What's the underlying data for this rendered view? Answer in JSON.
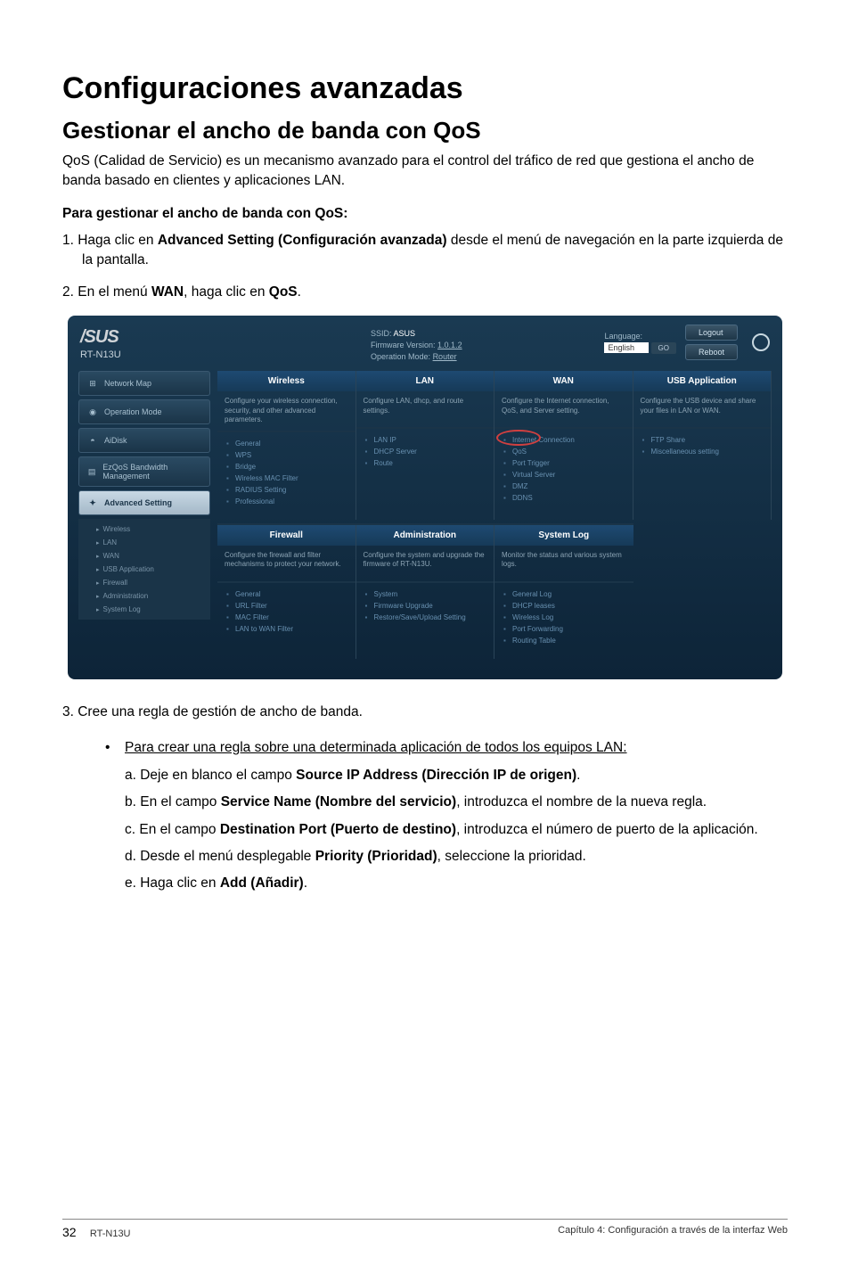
{
  "page": {
    "title": "Configuraciones avanzadas",
    "subtitle": "Gestionar el ancho de banda con QoS",
    "intro": "QoS (Calidad de Servicio) es un mecanismo avanzado para el control del tráfico de red que gestiona el ancho de banda basado en clientes y aplicaciones LAN.",
    "subheading": "Para gestionar el ancho de banda con QoS:",
    "step1_pre": "1.  Haga clic en ",
    "step1_bold": "Advanced Setting (Configuración avanzada)",
    "step1_post": " desde el menú de navegación en la parte izquierda de la pantalla.",
    "step2_pre": "2.  En el menú ",
    "step2_bold1": "WAN",
    "step2_mid": ", haga clic en ",
    "step2_bold2": "QoS",
    "step2_end": ".",
    "step3": "3.  Cree una regla de gestión de ancho de banda.",
    "bullet_head": "Para crear una regla sobre una determinada aplicación de todos los equipos LAN:",
    "letters": {
      "a": {
        "pre": "a. Deje en blanco el campo ",
        "b": "Source IP Address (Dirección IP de origen)",
        "post": "."
      },
      "b": {
        "pre": "b. En el campo ",
        "b": "Service Name (Nombre del servicio)",
        "post": ", introduzca el nombre de la nueva regla."
      },
      "c": {
        "pre": "c. En el campo ",
        "b": "Destination Port (Puerto de destino)",
        "post": ", introduzca el número de puerto de la aplicación."
      },
      "d": {
        "pre": "d. Desde el menú desplegable ",
        "b": "Priority (Prioridad)",
        "post": ", seleccione la prioridad."
      },
      "e": {
        "pre": "e. Haga clic en ",
        "b": "Add (Añadir)",
        "post": "."
      }
    }
  },
  "router": {
    "brand": "/SUS",
    "model": "RT-N13U",
    "header": {
      "ssid_label": "SSID:",
      "ssid": "ASUS",
      "fw_label": "Firmware Version:",
      "fw": "1.0.1.2",
      "op_label": "Operation Mode:",
      "op": "Router",
      "lang_label": "Language:",
      "lang_value": "English",
      "go": "GO",
      "logout": "Logout",
      "reboot": "Reboot"
    },
    "sidebar": {
      "network_map": "Network Map",
      "operation_mode": "Operation Mode",
      "aidisk": "AiDisk",
      "ezqos": "EzQoS Bandwidth Management",
      "advanced": "Advanced Setting",
      "subs": [
        "Wireless",
        "LAN",
        "WAN",
        "USB Application",
        "Firewall",
        "Administration",
        "System Log"
      ]
    },
    "grid": {
      "cols": [
        {
          "head": "Wireless",
          "desc": "Configure your wireless connection, security, and other advanced parameters.",
          "links": [
            "General",
            "WPS",
            "Bridge",
            "Wireless MAC Filter",
            "RADIUS Setting",
            "Professional"
          ]
        },
        {
          "head": "LAN",
          "desc": "Configure LAN, dhcp, and route settings.",
          "links": [
            "LAN IP",
            "DHCP Server",
            "Route"
          ]
        },
        {
          "head": "WAN",
          "desc": "Configure the Internet connection, QoS, and Server setting.",
          "links": [
            "Internet Connection",
            "QoS",
            "Port Trigger",
            "Virtual Server",
            "DMZ",
            "DDNS"
          ]
        },
        {
          "head": "USB Application",
          "desc": "Configure the USB device and share your files in LAN or WAN.",
          "links": [
            "FTP Share",
            "Miscellaneous setting"
          ]
        }
      ],
      "row2": [
        {
          "head": "Firewall",
          "desc": "Configure the firewall and filter mechanisms to protect your network.",
          "links": [
            "General",
            "URL Filter",
            "MAC Filter",
            "LAN to WAN Filter"
          ]
        },
        {
          "head": "Administration",
          "desc": "Configure the system and upgrade the firmware of RT-N13U.",
          "links": [
            "System",
            "Firmware Upgrade",
            "Restore/Save/Upload Setting"
          ]
        },
        {
          "head": "System Log",
          "desc": "Monitor the status and various system logs.",
          "links": [
            "General Log",
            "DHCP leases",
            "Wireless Log",
            "Port Forwarding",
            "Routing Table"
          ]
        }
      ]
    }
  },
  "footer": {
    "page": "32",
    "model": "RT-N13U",
    "chapter": "Capítulo 4: Configuración a través de la interfaz Web"
  }
}
